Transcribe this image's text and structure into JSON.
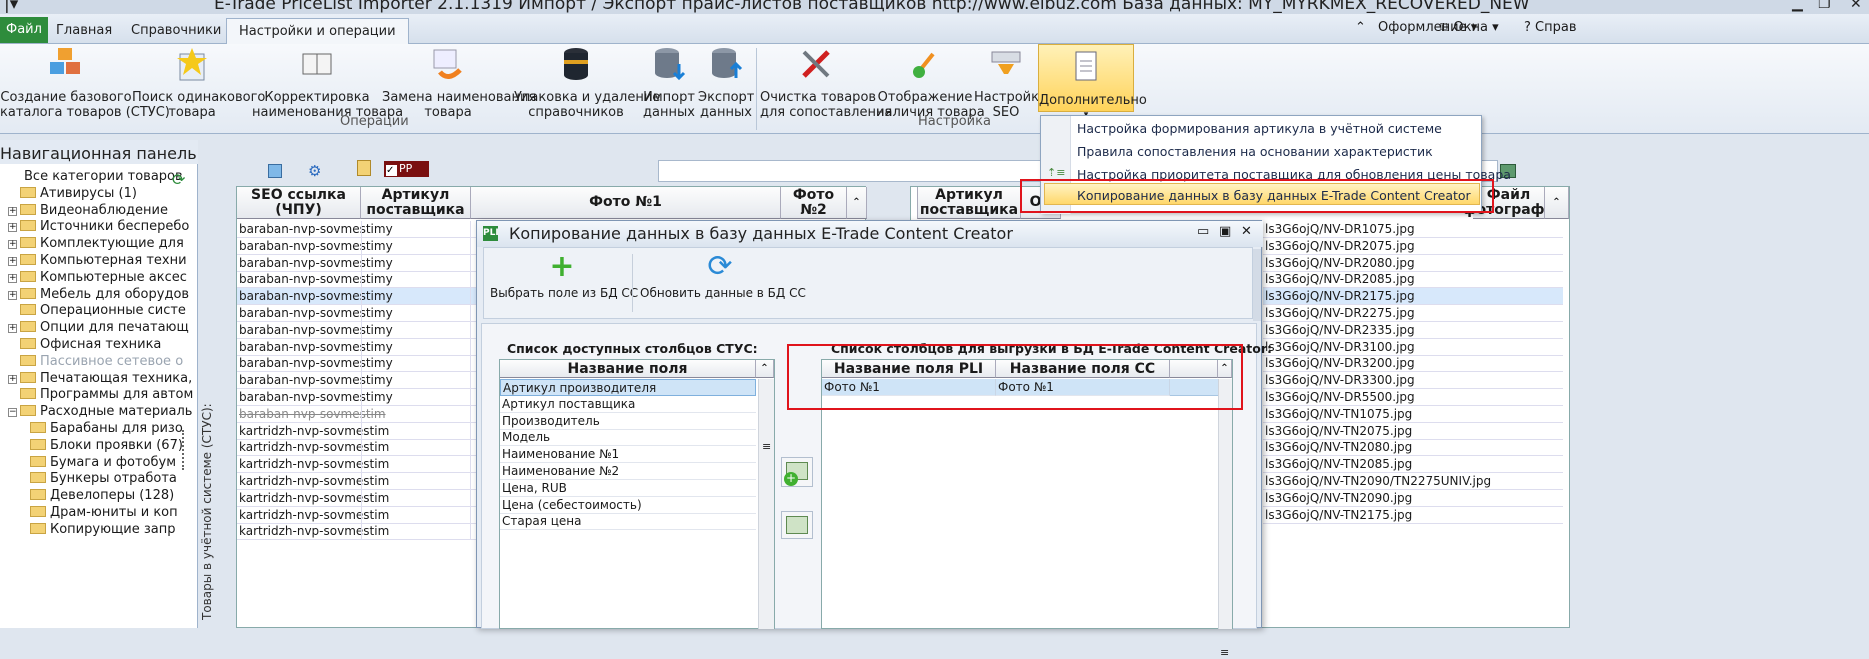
{
  "window": {
    "title": "E-Trade PriceList Importer 2.1.1319    Импорт / Экспорт прайс-листов поставщиков    http://www.elbuz.com    База данных: MY_MYRKMEX_RECOVERED_NEW"
  },
  "menu": {
    "file": "Файл",
    "tabs": [
      "Главная",
      "Справочники",
      "Настройки и операции"
    ],
    "right": [
      "Оформление",
      "Окна",
      "Справ"
    ]
  },
  "ribbon": {
    "buttons": [
      {
        "label": "Создание базового\nкаталога товаров (СТУС)"
      },
      {
        "label": "Поиск одинакового\nтовара"
      },
      {
        "label": "Корректировка\nнаименования товара"
      },
      {
        "label": "Замена наименования\nтовара"
      },
      {
        "label": "Упаковка и удаление\nсправочников"
      },
      {
        "label": "Импорт\nданных"
      },
      {
        "label": "Экспорт\nданных"
      },
      {
        "label": "Очистка товаров\nдля сопоставления"
      },
      {
        "label": "Отображение\nналичия товара"
      },
      {
        "label": "Настройка\nSEO"
      },
      {
        "label": "Дополнительно"
      }
    ],
    "groups": [
      "Операции",
      "Настройка"
    ]
  },
  "dropdown": {
    "items": [
      "Настройка формирования артикула в учётной системе",
      "Правила сопоставления на основании характеристик",
      "Настройка приоритета поставщика для обновления цены товара",
      "Копирование данных в базу данных E-Trade Content Creator"
    ]
  },
  "nav": {
    "title": "Навигационная панель",
    "side_label": "Товары в учётной системе (СТУС):",
    "items": [
      "Все категории товаров",
      "Ативирусы (1)",
      "Видеонаблюдение",
      "Источники бесперебо",
      "Комплектующие для",
      "Компьютерная техни",
      "Компьютерные аксес",
      "Мебель для оборудов",
      "Операционные систе",
      "Опции для печатающ",
      "Офисная техника",
      "Пассивное сетевое о",
      "Печатающая техника,",
      "Программы для автом",
      "Расходные материаль",
      "Барабаны для ризо",
      "Блоки проявки (67)",
      "Бумага и фотобум",
      "Бункеры отработа",
      "Девелоперы (128)",
      "Драм-юниты и коп",
      "Копирующие запр"
    ]
  },
  "grid": {
    "headers": [
      "SEO ссылка (ЧПУ)",
      "Артикул поставщика",
      "Фото №1",
      "Фото №2"
    ],
    "rows": [
      "baraban-nvp-sovmestimy",
      "baraban-nvp-sovmestimy",
      "baraban-nvp-sovmestimy",
      "baraban-nvp-sovmestimy",
      "baraban-nvp-sovmestimy",
      "baraban-nvp-sovmestimy",
      "baraban-nvp-sovmestimy",
      "baraban-nvp-sovmestimy",
      "baraban-nvp-sovmestimy",
      "baraban-nvp-sovmestimy",
      "baraban-nvp-sovmestimy",
      "baraban-nvp-sovmestim",
      "kartridzh-nvp-sovmestim",
      "kartridzh-nvp-sovmestim",
      "kartridzh-nvp-sovmestim",
      "kartridzh-nvp-sovmestim",
      "kartridzh-nvp-sovmestim",
      "kartridzh-nvp-sovmestim",
      "kartridzh-nvp-sovmestim"
    ],
    "filter_chip": "PP"
  },
  "rgrid": {
    "headers": [
      "Артикул поставщика",
      "Об",
      "Файл фотографи"
    ],
    "files": [
      "ls3G6ojQ/NV-DR1075.jpg",
      "ls3G6ojQ/NV-DR2075.jpg",
      "ls3G6ojQ/NV-DR2080.jpg",
      "ls3G6ojQ/NV-DR2085.jpg",
      "ls3G6ojQ/NV-DR2175.jpg",
      "ls3G6ojQ/NV-DR2275.jpg",
      "ls3G6ojQ/NV-DR2335.jpg",
      "ls3G6ojQ/NV-DR3100.jpg",
      "ls3G6ojQ/NV-DR3200.jpg",
      "ls3G6ojQ/NV-DR3300.jpg",
      "ls3G6ojQ/NV-DR5500.jpg",
      "ls3G6ojQ/NV-TN1075.jpg",
      "ls3G6ojQ/NV-TN2075.jpg",
      "ls3G6ojQ/NV-TN2080.jpg",
      "ls3G6ojQ/NV-TN2085.jpg",
      "ls3G6ojQ/NV-TN2090/TN2275UNIV.jpg",
      "ls3G6ojQ/NV-TN2090.jpg",
      "ls3G6ojQ/NV-TN2175.jpg"
    ]
  },
  "dialog": {
    "title": "Копирование данных в базу данных E-Trade Content Creator",
    "btn_select": "Выбрать поле из БД CC",
    "btn_refresh": "Обновить данные в БД CC",
    "left_title": "Список доступных столбцов СТУС:",
    "left_header": "Название поля",
    "left_rows": [
      "Артикул производителя",
      "Артикул поставщика",
      "Производитель",
      "Модель",
      "Наименование №1",
      "Наименование №2",
      "Цена, RUB",
      "Цена (себестоимость)",
      "Старая цена"
    ],
    "right_title": "Список столбцов для выгрузки в БД E-Trade Content Creator:",
    "right_headers": [
      "Название поля PLI",
      "Название поля CC"
    ],
    "right_row": [
      "Фото №1",
      "Фото №1"
    ]
  },
  "colors": {
    "accent_green": "#2e8c3c",
    "highlight_yellow": "#ffd86b",
    "selection": "#cfe4f7",
    "red_box": "#e0141c"
  }
}
